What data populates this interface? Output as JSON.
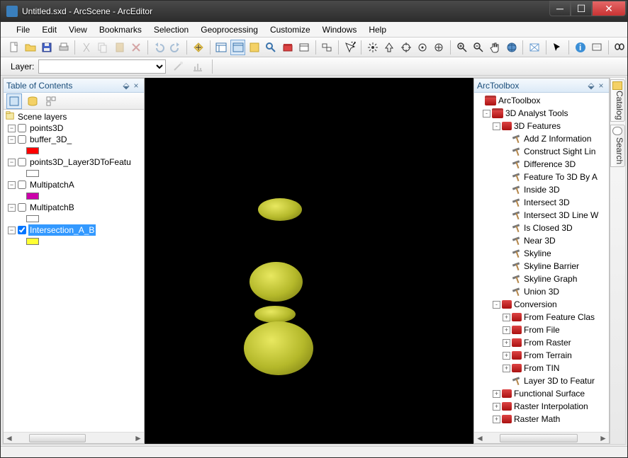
{
  "title": "Untitled.sxd - ArcScene - ArcEditor",
  "menus": [
    "File",
    "Edit",
    "View",
    "Bookmarks",
    "Selection",
    "Geoprocessing",
    "Customize",
    "Windows",
    "Help"
  ],
  "layer_label": "Layer:",
  "toc": {
    "title": "Table of Contents",
    "root": "Scene layers",
    "layers": [
      {
        "name": "points3D",
        "checked": false,
        "swatch": null
      },
      {
        "name": "buffer_3D_",
        "checked": false,
        "swatch": "#ff0000"
      },
      {
        "name": "points3D_Layer3DToFeatu",
        "checked": false,
        "swatch": "#ffffff"
      },
      {
        "name": "MultipatchA",
        "checked": false,
        "swatch": "#cc00aa"
      },
      {
        "name": "MultipatchB",
        "checked": false,
        "swatch": "#ffffff"
      },
      {
        "name": "Intersection_A_B",
        "checked": true,
        "swatch": "#ffff33",
        "selected": true
      }
    ]
  },
  "arctoolbox": {
    "title": "ArcToolbox",
    "root": "ArcToolbox",
    "toolbox": "3D Analyst Tools",
    "sets": {
      "features": {
        "name": "3D Features",
        "tools": [
          "Add Z Information",
          "Construct Sight Lin",
          "Difference 3D",
          "Feature To 3D By A",
          "Inside 3D",
          "Intersect 3D",
          "Intersect 3D Line W",
          "Is Closed 3D",
          "Near 3D",
          "Skyline",
          "Skyline Barrier",
          "Skyline Graph",
          "Union 3D"
        ]
      },
      "conversion": {
        "name": "Conversion",
        "subs": [
          "From Feature Clas",
          "From File",
          "From Raster",
          "From Terrain",
          "From TIN"
        ],
        "tool": "Layer 3D to Featur"
      },
      "others": [
        "Functional Surface",
        "Raster Interpolation",
        "Raster Math"
      ]
    }
  },
  "side_tabs": [
    "Catalog",
    "Search"
  ]
}
